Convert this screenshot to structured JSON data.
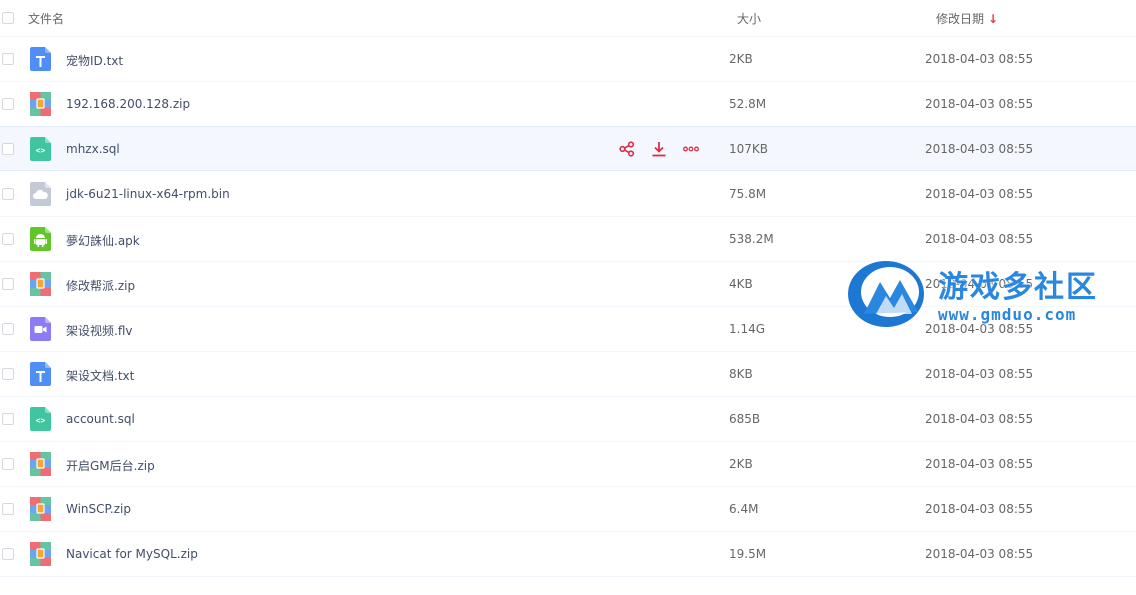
{
  "header": {
    "name_label": "文件名",
    "size_label": "大小",
    "date_label": "修改日期",
    "sort_arrow": "↓"
  },
  "files": [
    {
      "name": "宠物ID.txt",
      "size": "2KB",
      "date": "2018-04-03 08:55",
      "type": "txt"
    },
    {
      "name": "192.168.200.128.zip",
      "size": "52.8M",
      "date": "2018-04-03 08:55",
      "type": "zip"
    },
    {
      "name": "mhzx.sql",
      "size": "107KB",
      "date": "2018-04-03 08:55",
      "type": "code"
    },
    {
      "name": "jdk-6u21-linux-x64-rpm.bin",
      "size": "75.8M",
      "date": "2018-04-03 08:55",
      "type": "bin"
    },
    {
      "name": "夢幻誅仙.apk",
      "size": "538.2M",
      "date": "2018-04-03 08:55",
      "type": "apk"
    },
    {
      "name": "修改帮派.zip",
      "size": "4KB",
      "date": "2018-04-03 08:55",
      "type": "zip"
    },
    {
      "name": "架设视频.flv",
      "size": "1.14G",
      "date": "2018-04-03 08:55",
      "type": "video"
    },
    {
      "name": "架设文档.txt",
      "size": "8KB",
      "date": "2018-04-03 08:55",
      "type": "txt"
    },
    {
      "name": "account.sql",
      "size": "685B",
      "date": "2018-04-03 08:55",
      "type": "code"
    },
    {
      "name": "开启GM后台.zip",
      "size": "2KB",
      "date": "2018-04-03 08:55",
      "type": "zip"
    },
    {
      "name": "WinSCP.zip",
      "size": "6.4M",
      "date": "2018-04-03 08:55",
      "type": "zip"
    },
    {
      "name": "Navicat for MySQL.zip",
      "size": "19.5M",
      "date": "2018-04-03 08:55",
      "type": "zip"
    }
  ],
  "hover_row_index": 2,
  "row_actions": {
    "share_icon": "share-icon",
    "download_icon": "download-icon",
    "more_icon": "more-icon"
  },
  "watermark": {
    "text_cn": "游戏多社区",
    "url": "www.gmduo.com"
  },
  "colors": {
    "accent": "#2a87e0",
    "action_red": "#d9304a",
    "sort_red": "#e53a3a"
  }
}
